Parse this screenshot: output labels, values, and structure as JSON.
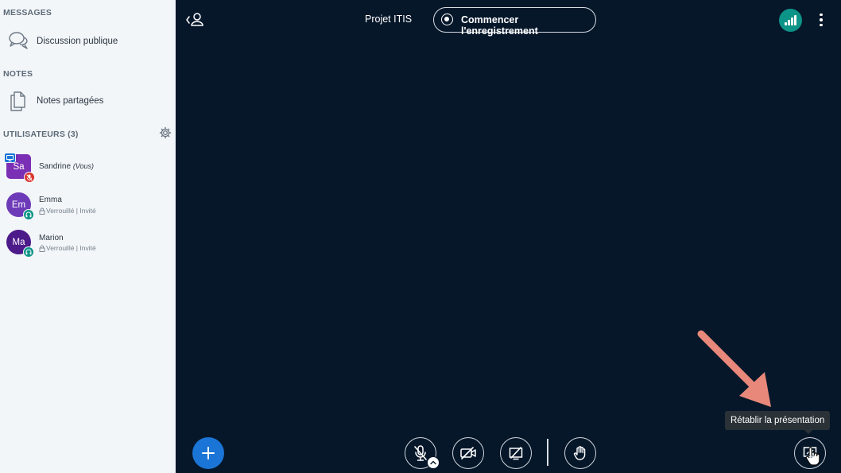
{
  "sidebar": {
    "messages_title": "MESSAGES",
    "public_chat_label": "Discussion publique",
    "notes_title": "NOTES",
    "shared_notes_label": "Notes partagées",
    "users_title": "UTILISATEURS (3)",
    "users": [
      {
        "initials": "Sa",
        "name": "Sandrine",
        "you_tag": "(Vous)",
        "avatar_color": "#7b2fb4",
        "meta": ""
      },
      {
        "initials": "Em",
        "name": "Emma",
        "you_tag": "",
        "avatar_color": "#6e3bb8",
        "meta": "Verrouillé | Invité"
      },
      {
        "initials": "Ma",
        "name": "Marion",
        "you_tag": "",
        "avatar_color": "#4d1a8a",
        "meta": "Verrouillé | Invité"
      }
    ]
  },
  "header": {
    "meeting_title": "Projet ITIS",
    "record_label": "Commencer l'enregistrement"
  },
  "tooltip": {
    "text": "Rétablir la présentation"
  },
  "colors": {
    "background": "#06172a",
    "sidebar": "#f3f6f9",
    "accent_blue": "#1b75d6",
    "connection_green": "#0d9488",
    "annotation_arrow": "#e8887a"
  },
  "icons": {
    "chat": "chat-bubbles-icon",
    "notes": "notes-icon",
    "settings": "gear-icon",
    "back": "users-back-icon",
    "connection": "signal-bars-icon",
    "menu": "vertical-dots-icon",
    "add": "plus-icon",
    "mic": "mic-muted-icon",
    "camera": "camera-off-icon",
    "screen": "screen-share-off-icon",
    "hand": "raise-hand-icon",
    "presentation": "restore-presentation-icon"
  }
}
